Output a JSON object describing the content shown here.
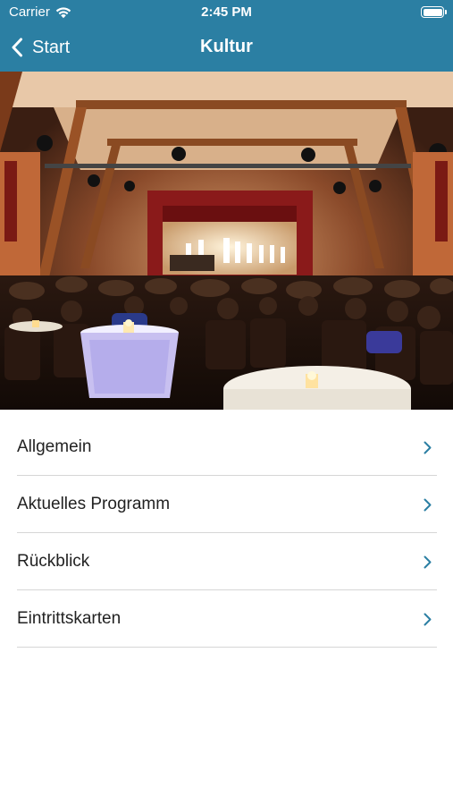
{
  "status_bar": {
    "carrier": "Carrier",
    "time": "2:45 PM",
    "wifi_icon": "wifi-icon",
    "battery_icon": "battery-icon",
    "battery_level": 1.0
  },
  "nav": {
    "back_label": "Start",
    "back_icon": "chevron-left-icon",
    "title": "Kultur"
  },
  "hero": {
    "subject": "concert hall photo"
  },
  "menu": {
    "items": [
      {
        "label": "Allgemein",
        "icon": "chevron-right-icon"
      },
      {
        "label": "Aktuelles Programm",
        "icon": "chevron-right-icon"
      },
      {
        "label": "Rückblick",
        "icon": "chevron-right-icon"
      },
      {
        "label": "Eintrittskarten",
        "icon": "chevron-right-icon"
      }
    ]
  },
  "colors": {
    "header_bg": "#2b7fa3",
    "header_text": "#ffffff",
    "accent": "#2b7fa3",
    "divider": "#d6d6d6",
    "text": "#222222"
  }
}
